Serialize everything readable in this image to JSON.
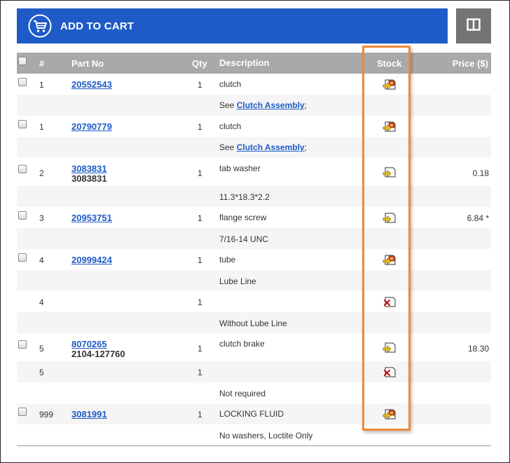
{
  "toolbar": {
    "add_to_cart_label": "ADD TO CART",
    "accent_color": "#1e5bc6",
    "secondary_button_color": "#747474",
    "icons": {
      "cart": "cart-icon",
      "columns": "columns-icon"
    }
  },
  "table": {
    "headers": {
      "select_all": "",
      "num": "#",
      "part_no": "Part No",
      "qty": "Qty",
      "description": "Description",
      "stock": "Stock",
      "price": "Price ($)"
    },
    "header_bg": "#a9a9a9",
    "highlight_color": "#ef8a35",
    "rows": [
      {
        "num": "1",
        "part": "20552543",
        "qty": "1",
        "desc": "clutch",
        "stock": "available-warehouse"
      },
      {
        "see": "See ",
        "link": "Clutch Assembly",
        "after": ";"
      },
      {
        "num": "1",
        "part": "20790779",
        "qty": "1",
        "desc": "clutch",
        "stock": "available-warehouse"
      },
      {
        "see": "See ",
        "link": "Clutch Assembly",
        "after": ";"
      },
      {
        "num": "2",
        "part": "3083831",
        "sub": "3083831",
        "qty": "1",
        "desc": "tab washer",
        "stock": "available",
        "price": "0.18"
      },
      {
        "note": "11.3*18.3*2.2"
      },
      {
        "num": "3",
        "part": "20953751",
        "qty": "1",
        "desc": "flange screw",
        "stock": "available",
        "price": "6.84 *"
      },
      {
        "note": "7/16-14 UNC"
      },
      {
        "num": "4",
        "part": "20999424",
        "qty": "1",
        "desc": "tube",
        "stock": "available-warehouse"
      },
      {
        "note": "Lube Line"
      },
      {
        "num": "4",
        "qty": "1",
        "stock": "unavailable"
      },
      {
        "note": "Without Lube Line"
      },
      {
        "num": "5",
        "part": "8070265",
        "sub": "2104-127760",
        "qty": "1",
        "desc": "clutch brake",
        "stock": "available",
        "price": "18.30"
      },
      {
        "num": "5",
        "qty": "1",
        "stock": "unavailable"
      },
      {
        "note": "Not required"
      },
      {
        "num": "999",
        "part": "3081991",
        "qty": "1",
        "desc": "LOCKING FLUID",
        "stock": "available-warehouse"
      },
      {
        "note": "No washers, Loctite Only"
      }
    ]
  }
}
